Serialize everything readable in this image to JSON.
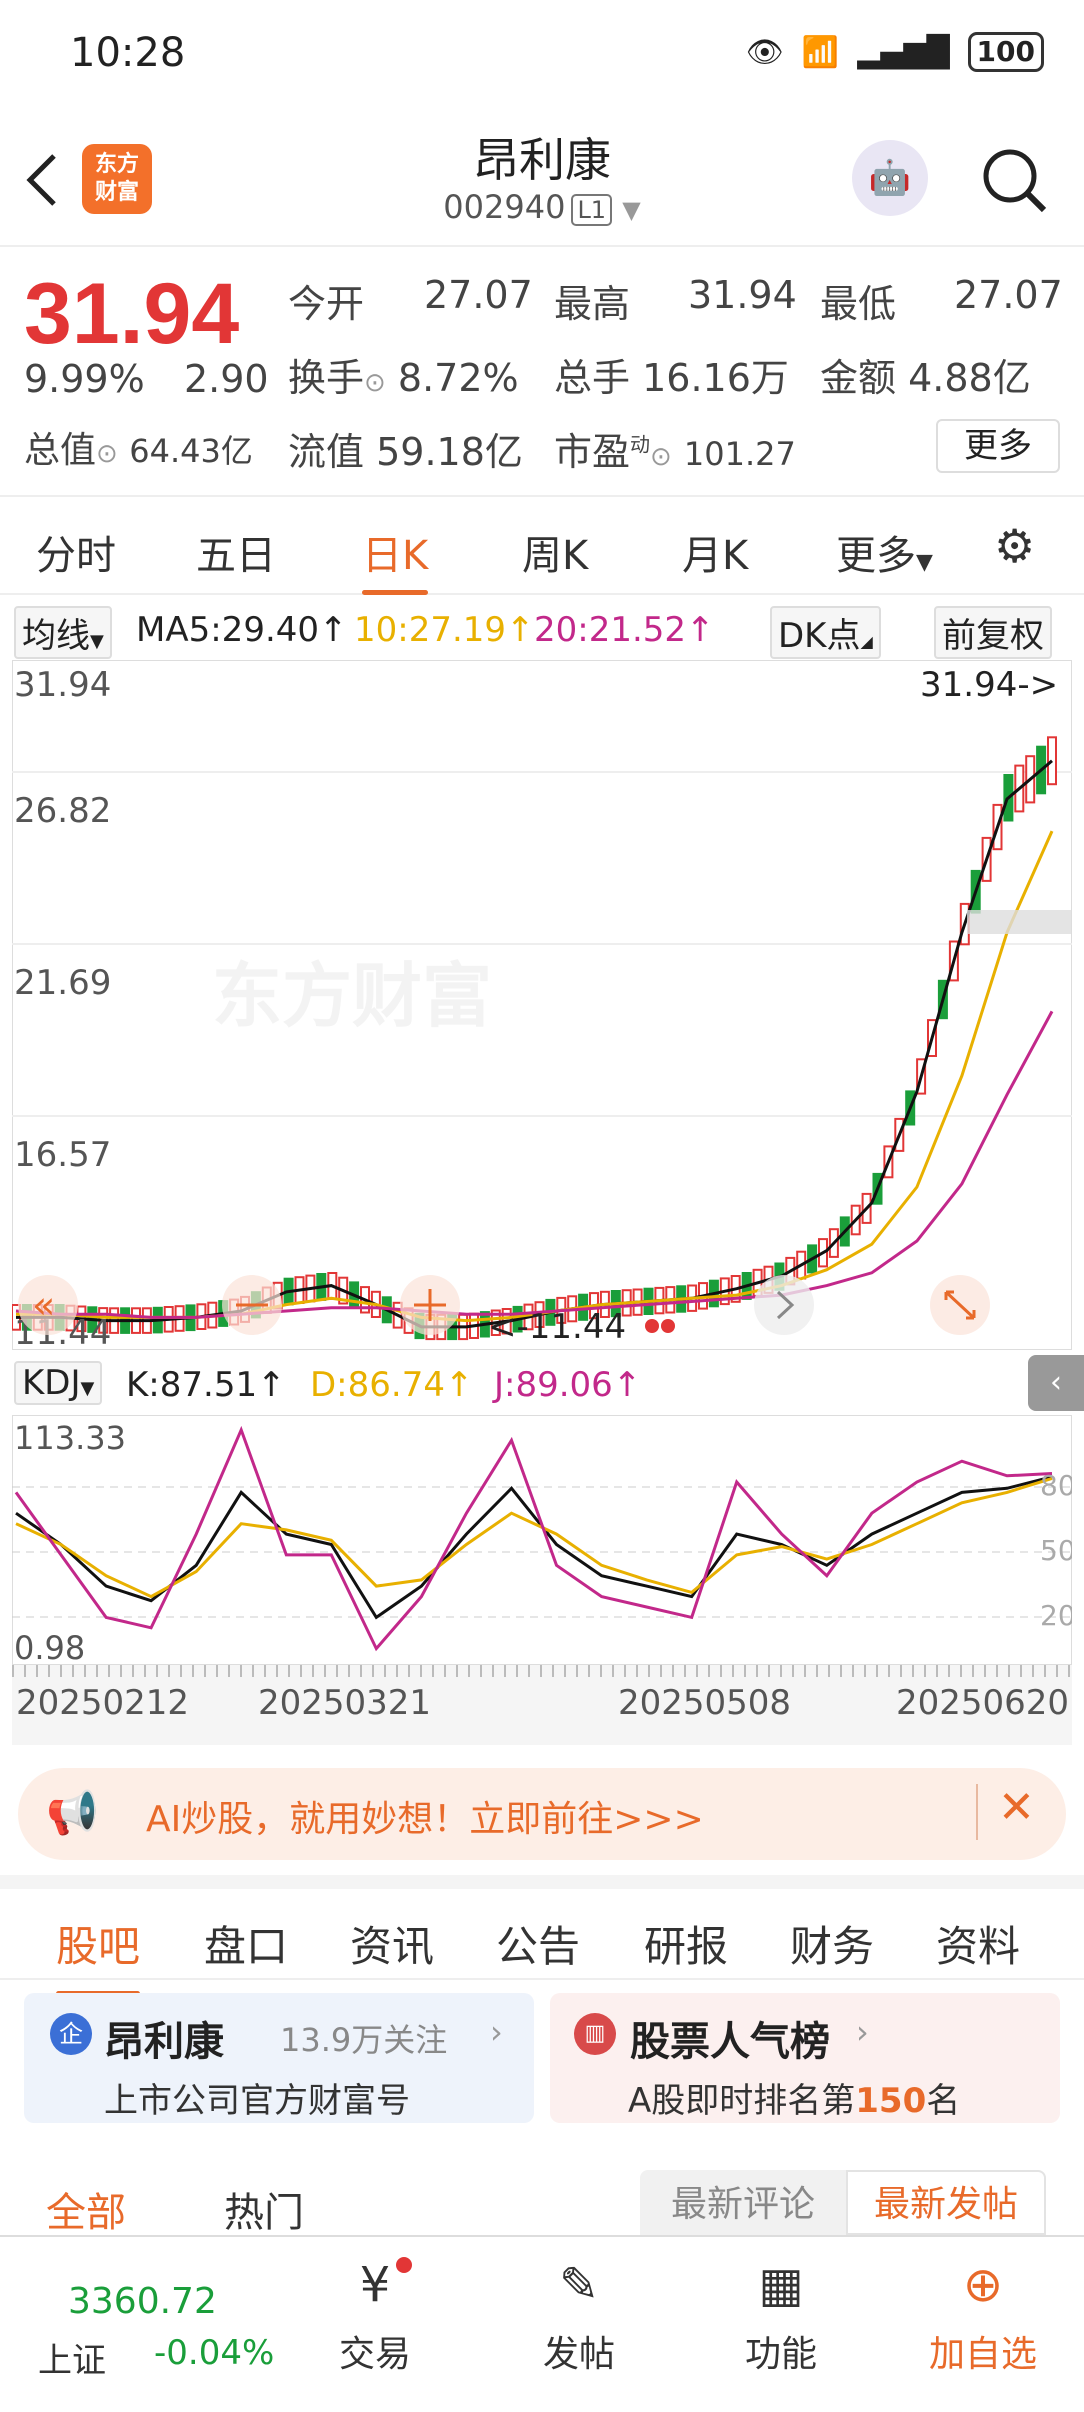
{
  "status": {
    "time": "10:28",
    "battery": "100"
  },
  "header": {
    "title": "昂利康",
    "code": "002940",
    "level": "L1",
    "logo_line1": "东方",
    "logo_line2": "财富"
  },
  "quote": {
    "price": "31.94",
    "change_pct": "9.99%",
    "change": "2.90",
    "open_label": "今开",
    "open": "27.07",
    "high_label": "最高",
    "high": "31.94",
    "low_label": "最低",
    "low": "27.07",
    "turnover_label": "换手",
    "turnover": "8.72%",
    "volume_label": "总手",
    "volume": "16.16万",
    "amount_label": "金额",
    "amount": "4.88亿",
    "mcap_label": "总值",
    "mcap": "64.43亿",
    "float_label": "流值",
    "float": "59.18亿",
    "pe_label": "市盈",
    "pe_sup": "动",
    "pe": "101.27",
    "more": "更多"
  },
  "tabs": [
    "分时",
    "五日",
    "日K",
    "周K",
    "月K",
    "更多"
  ],
  "ma": {
    "selector": "均线",
    "ma5": "MA5:29.40↑",
    "ma10": "10:27.19↑",
    "ma20": "20:21.52↑",
    "dk": "DK点",
    "fq": "前复权"
  },
  "kline_axis": [
    "31.94",
    "26.82",
    "21.69",
    "16.57",
    "11.44"
  ],
  "kline_marks": {
    "high": "31.94->",
    "low": "<-11.44"
  },
  "watermark": "东方财富",
  "kdj": {
    "selector": "KDJ",
    "k": "K:87.51↑",
    "d": "D:86.74↑",
    "j": "J:89.06↑",
    "axis_top": "113.33",
    "axis_bottom": "0.98",
    "lv80": "80",
    "lv50": "50",
    "lv20": "20"
  },
  "dates": [
    "20250212",
    "20250321",
    "20250508",
    "20250620"
  ],
  "banner": {
    "text": "AI炒股，就用妙想！立即前往>>>"
  },
  "content_tabs": [
    "股吧",
    "盘口",
    "资讯",
    "公告",
    "研报",
    "财务",
    "资料"
  ],
  "card1": {
    "badge": "企",
    "name": "昂利康",
    "follow": "13.9万关注",
    "sub": "上市公司官方财富号"
  },
  "card2": {
    "name": "股票人气榜",
    "sub_pre": "A股即时排名第",
    "rank": "150",
    "sub_post": "名"
  },
  "feed": {
    "all": "全部",
    "hot": "热门",
    "latest_comment": "最新评论",
    "latest_post": "最新发帖"
  },
  "bottom": {
    "index_value": "3360.72",
    "index_name": "上证",
    "index_change": "-0.04%",
    "trade": "交易",
    "post": "发帖",
    "func": "功能",
    "add": "加自选"
  },
  "colors": {
    "up": "#e23636",
    "down": "#1a9e3a",
    "accent": "#e86a2a",
    "ma10": "#e8b000",
    "ma20": "#c2288a"
  },
  "chart_data": [
    {
      "type": "line",
      "title": "",
      "series": [
        {
          "name": "MA5",
          "values": [
            11.9,
            11.9,
            11.8,
            11.8,
            11.9,
            12.1,
            12.7,
            12.9,
            12.3,
            11.6,
            11.6,
            11.8,
            12.1,
            12.3,
            12.4,
            12.5,
            12.8,
            13.2,
            14.0,
            15.5,
            19.0,
            24.0,
            28.2,
            29.4
          ]
        },
        {
          "name": "MA10",
          "values": [
            12.0,
            12.0,
            11.9,
            11.9,
            11.9,
            12.0,
            12.3,
            12.5,
            12.3,
            11.9,
            11.8,
            11.9,
            12.1,
            12.3,
            12.4,
            12.5,
            12.6,
            12.9,
            13.4,
            14.2,
            16.0,
            19.5,
            24.0,
            27.19
          ]
        },
        {
          "name": "MA20",
          "values": [
            12.1,
            12.0,
            12.0,
            11.9,
            11.9,
            12.0,
            12.1,
            12.2,
            12.2,
            12.1,
            12.0,
            12.0,
            12.1,
            12.2,
            12.3,
            12.4,
            12.5,
            12.6,
            12.9,
            13.3,
            14.3,
            16.1,
            18.9,
            21.52
          ]
        }
      ],
      "ylim": [
        11.44,
        31.94
      ]
    },
    {
      "type": "line",
      "title": "",
      "series": [
        {
          "name": "K",
          "values": [
            70,
            55,
            35,
            28,
            45,
            80,
            60,
            55,
            20,
            35,
            60,
            82,
            55,
            40,
            35,
            30,
            60,
            55,
            45,
            60,
            70,
            80,
            82,
            87.51
          ]
        },
        {
          "name": "D",
          "values": [
            65,
            55,
            40,
            30,
            42,
            65,
            62,
            57,
            35,
            38,
            55,
            70,
            60,
            45,
            38,
            32,
            50,
            54,
            48,
            55,
            65,
            75,
            80,
            86.74
          ]
        },
        {
          "name": "J",
          "values": [
            80,
            50,
            20,
            15,
            60,
            110,
            50,
            50,
            5,
            30,
            70,
            105,
            45,
            30,
            25,
            20,
            85,
            60,
            40,
            70,
            85,
            95,
            88,
            89.06
          ]
        }
      ],
      "ylim": [
        0.98,
        113.33
      ]
    }
  ]
}
